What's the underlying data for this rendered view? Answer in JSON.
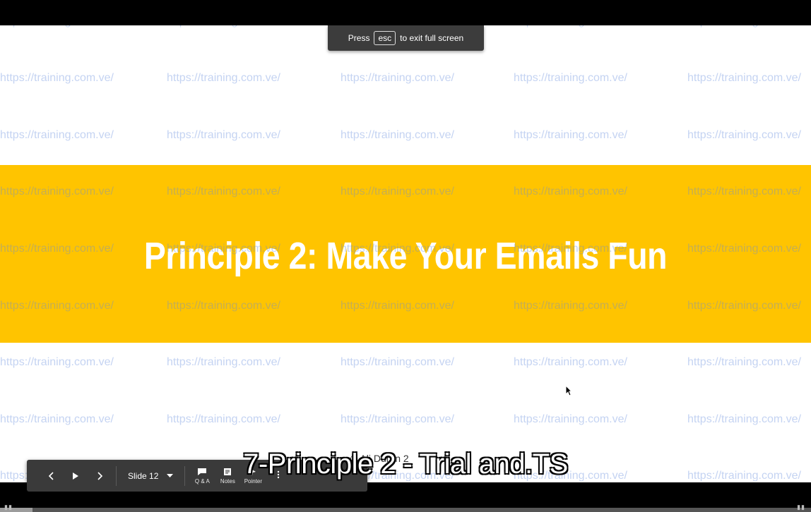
{
  "toast": {
    "press": "Press",
    "key": "esc",
    "message": "to exit full screen"
  },
  "slide": {
    "title": "Principle 2: Make Your Emails Fun",
    "footer": "© Ali Duran 2",
    "band_color": "#FFC400"
  },
  "watermark": {
    "text": "https://training.com.ve/"
  },
  "controls": {
    "slide_label": "Slide 12",
    "qa_label": "Q & A",
    "notes_label": "Notes",
    "pointer_label": "Pointer"
  },
  "caption": {
    "text": "7-Principle 2 - Trial and.TS"
  },
  "progress": {
    "fraction": 0.04
  }
}
